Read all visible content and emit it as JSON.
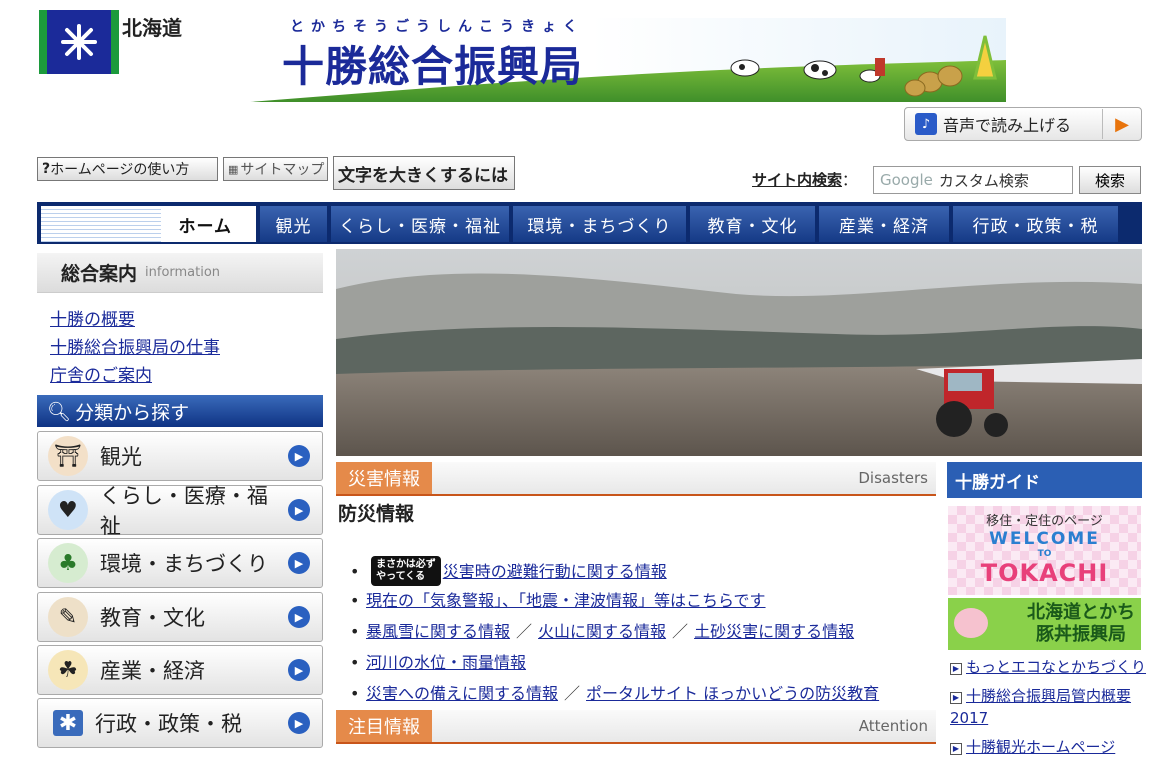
{
  "header": {
    "pref_name": "北海道",
    "title_ruby": "とかちそうごうしんこうきょく",
    "title": "十勝総合振興局",
    "voice_label": "音声で読み上げる"
  },
  "util": {
    "howto": "ホームページの使い方",
    "sitemap": "サイトマップ",
    "bigtext": "文字を大きくするには"
  },
  "search": {
    "label": "サイト内検索",
    "colon": "：",
    "google": "Google",
    "placeholder": "カスタム検索",
    "button": "検索"
  },
  "nav": {
    "home": "ホーム",
    "tabs": [
      "観光",
      "くらし・医療・福祉",
      "環境・まちづくり",
      "教育・文化",
      "産業・経済",
      "行政・政策・税"
    ]
  },
  "sidebar": {
    "info_title": "総合案内",
    "info_sub": "information",
    "info_links": [
      "十勝の概要",
      "十勝総合振興局の仕事",
      "庁舎のご案内"
    ],
    "cat_title": "分類から探す",
    "cats": [
      "観光",
      "くらし・医療・福祉",
      "環境・まちづくり",
      "教育・文化",
      "産業・経済",
      "行政・政策・税"
    ]
  },
  "disaster": {
    "label": "災害情報",
    "en": "Disasters",
    "subtitle": "防災情報",
    "badge_line1": "まさかは必ず",
    "badge_line2": "やってくる",
    "items": [
      {
        "a": "災害時の避難行動に関する情報"
      },
      {
        "a": "現在の「気象警報」、「地震・津波情報」等はこちらです"
      },
      {
        "a": "暴風雪に関する情報",
        "b": "火山に関する情報",
        "c": "土砂災害に関する情報"
      },
      {
        "a": "河川の水位・雨量情報"
      },
      {
        "a": "災害への備えに関する情報",
        "b": "ポータルサイト ほっかいどうの防災教育"
      }
    ],
    "slash": "／"
  },
  "attention": {
    "label": "注目情報",
    "en": "Attention"
  },
  "guide": {
    "title": "十勝ガイド",
    "banner1_top": "移住・定住のページ",
    "banner1_welcome": "WELCOME",
    "banner1_to": "TO",
    "banner1_name": "TOKACHI",
    "banner2_line1": "北海道とかち",
    "banner2_line2": "豚丼振興局",
    "links": [
      "もっとエコなとかちづくり",
      "十勝総合振興局管内概要2017",
      "十勝観光ホームページ"
    ]
  }
}
